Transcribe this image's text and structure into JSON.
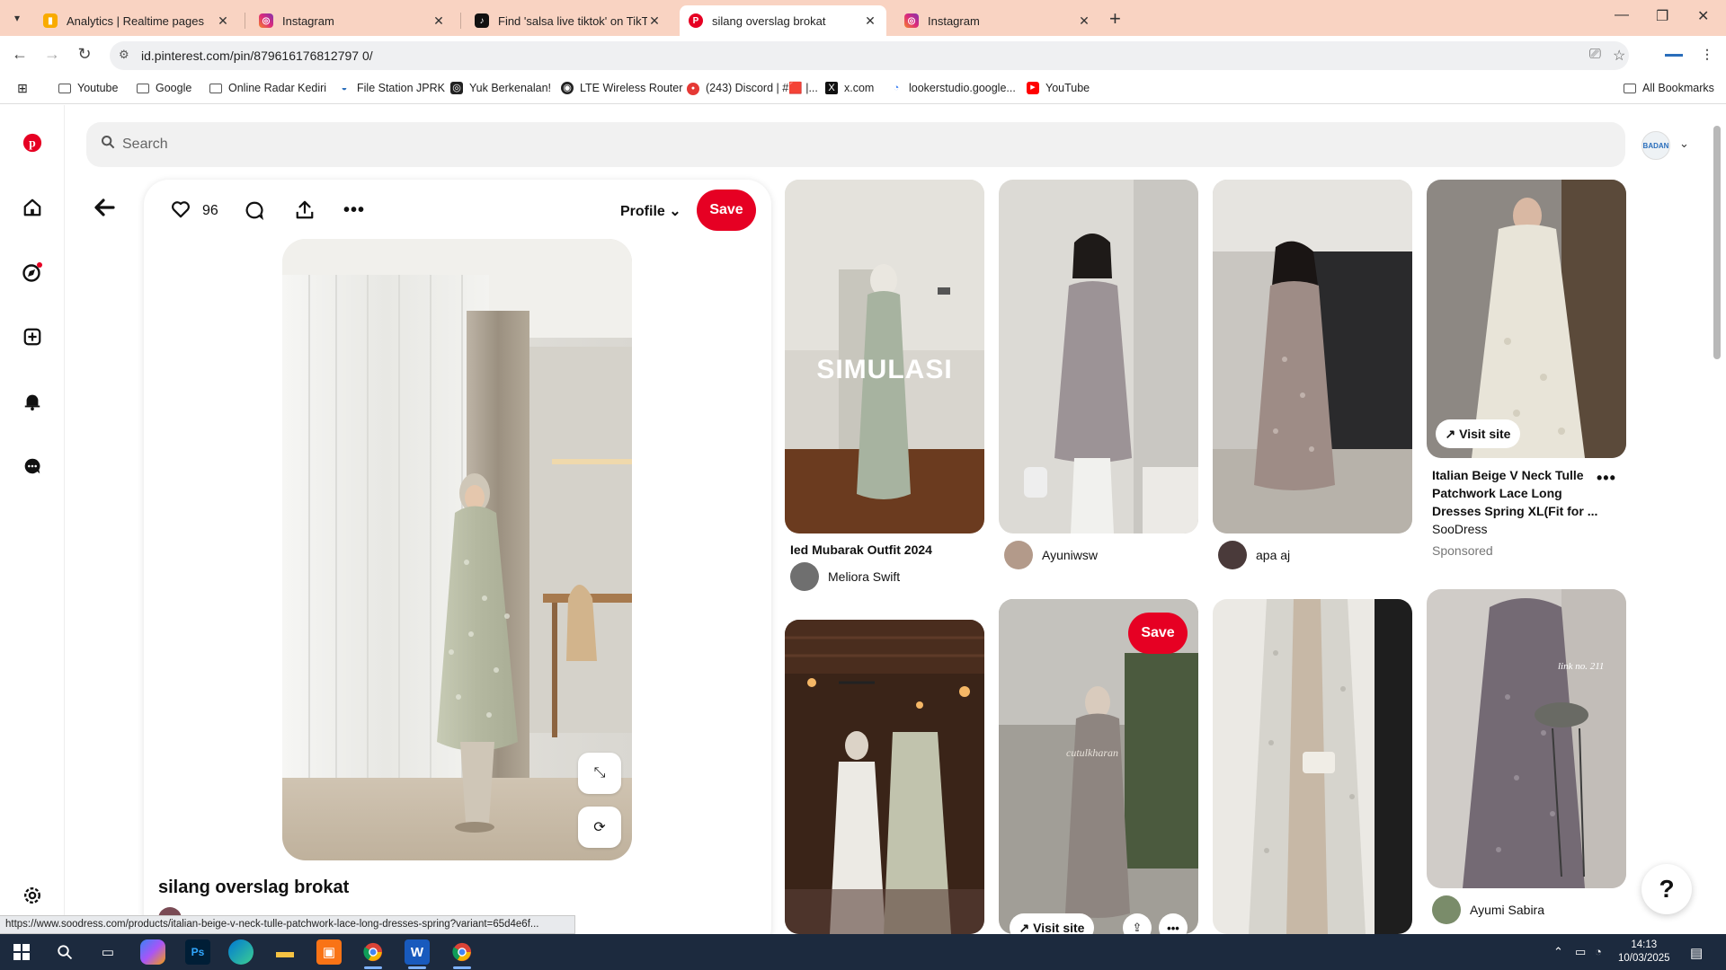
{
  "browser": {
    "tabs": [
      {
        "title": "Analytics | Realtime pages",
        "favicon": "analytics-icon"
      },
      {
        "title": "Instagram",
        "favicon": "instagram-icon"
      },
      {
        "title": "Find 'salsa live tiktok' on TikTok",
        "favicon": "tiktok-icon"
      },
      {
        "title": "silang overslag brokat",
        "favicon": "pinterest-icon",
        "active": true
      },
      {
        "title": "Instagram",
        "favicon": "instagram-icon"
      }
    ],
    "url": "id.pinterest.com/pin/879616176812797 0/",
    "bookmarks": [
      {
        "label": "Youtube",
        "icon": "folder-icon"
      },
      {
        "label": "Google",
        "icon": "folder-icon"
      },
      {
        "label": "Online Radar Kediri",
        "icon": "folder-icon"
      },
      {
        "label": "File Station JPRK",
        "icon": "file-station-icon"
      },
      {
        "label": "Yuk Berkenalan!",
        "icon": "instagram-icon"
      },
      {
        "label": "LTE Wireless Router",
        "icon": "router-icon"
      },
      {
        "label": "(243) Discord | #🟥 |...",
        "icon": "discord-icon"
      },
      {
        "label": "x.com",
        "icon": "x-icon"
      },
      {
        "label": "lookerstudio.google...",
        "icon": "looker-icon"
      },
      {
        "label": "YouTube",
        "icon": "youtube-icon"
      }
    ],
    "all_bookmarks": "All Bookmarks",
    "status_url": "https://www.soodress.com/products/italian-beige-v-neck-tulle-patchwork-lace-long-dresses-spring?variant=65d4e6f..."
  },
  "pinterest": {
    "search_placeholder": "Search",
    "avatar_text": "BADAN",
    "pin": {
      "likes": "96",
      "profile_label": "Profile",
      "save_label": "Save",
      "title": "silang overslag brokat"
    },
    "grid": {
      "col1": [
        {
          "overlay": "SIMULASI",
          "caption": "Ied Mubarak Outfit 2024",
          "author": "Meliora Swift"
        }
      ],
      "col2": [
        {
          "author": "Ayuniwsw"
        },
        {
          "save_label": "Save",
          "visit_label": "Visit site"
        }
      ],
      "col3": [
        {
          "author": "apa aj"
        }
      ],
      "col4": [
        {
          "visit_label": "Visit site",
          "caption": "Italian Beige V Neck Tulle Patchwork Lace Long Dresses Spring XL(Fit for ...",
          "source": "SooDress",
          "sponsored": "Sponsored"
        },
        {
          "author": "Ayumi Sabira",
          "overlay": "link no. 211"
        }
      ]
    },
    "help_label": "?"
  },
  "taskbar": {
    "time": "14:13",
    "date": "10/03/2025"
  },
  "colors": {
    "pinterest_red": "#e60023",
    "tabstrip": "#f9d3c2",
    "taskbar": "#1c2a3e"
  }
}
